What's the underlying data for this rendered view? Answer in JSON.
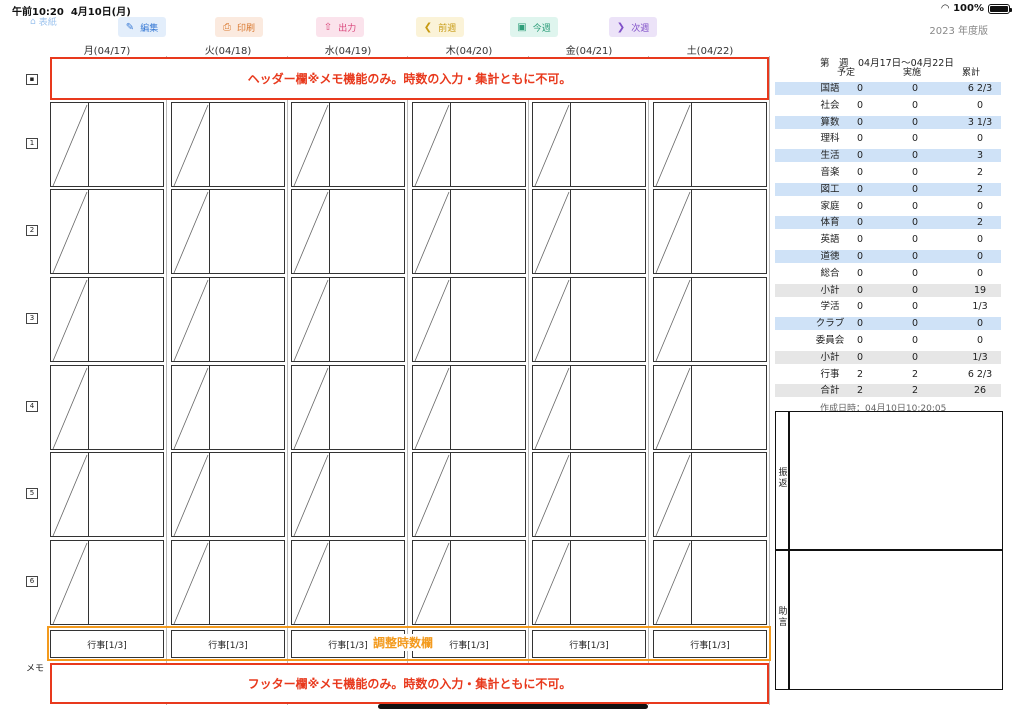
{
  "status": {
    "time": "午前10:20",
    "date": "4月10日(月)",
    "battery": "100%"
  },
  "nav": {
    "back": "表紙",
    "year": "2023 年度版"
  },
  "toolbar": [
    {
      "label": "編集",
      "icon": "edit-icon",
      "glyph": "✎",
      "bg": "#e3eefb",
      "fg": "#3a7bd5"
    },
    {
      "label": "印刷",
      "icon": "print-icon",
      "glyph": "⎙",
      "bg": "#fbeadf",
      "fg": "#d9782e"
    },
    {
      "label": "出力",
      "icon": "share-icon",
      "glyph": "⇧",
      "bg": "#fbe3ec",
      "fg": "#d9457a"
    },
    {
      "label": "前週",
      "icon": "prev-week-icon",
      "glyph": "❮",
      "bg": "#fbf3d8",
      "fg": "#c79a12"
    },
    {
      "label": "今週",
      "icon": "this-week-icon",
      "glyph": "▣",
      "bg": "#dff5ee",
      "fg": "#2e9e7a"
    },
    {
      "label": "次週",
      "icon": "next-week-icon",
      "glyph": "❯",
      "bg": "#ece3f8",
      "fg": "#8050c8"
    }
  ],
  "days": [
    "月(04/17)",
    "火(04/18)",
    "水(04/19)",
    "木(04/20)",
    "金(04/21)",
    "土(04/22)"
  ],
  "periods": [
    "1",
    "2",
    "3",
    "4",
    "5",
    "6"
  ],
  "header_note": "ヘッダー欄※メモ機能のみ。時数の入力・集計ともに不可。",
  "footer_note": "フッター欄※メモ機能のみ。時数の入力・集計ともに不可。",
  "adjust_label": "調整時数欄",
  "events": [
    "行事[1/3]",
    "行事[1/3]",
    "行事[1/3]",
    "行事[1/3]",
    "行事[1/3]",
    "行事[1/3]"
  ],
  "memo_label": "メモ",
  "summary": {
    "title": "第　週　04月17日～04月22日",
    "headers": [
      "予定",
      "実施",
      "累計"
    ],
    "rows": [
      {
        "subject": "国語",
        "planned": "0",
        "done": "0",
        "total": "6 2/3",
        "style": "hl"
      },
      {
        "subject": "社会",
        "planned": "0",
        "done": "0",
        "total": "0",
        "style": ""
      },
      {
        "subject": "算数",
        "planned": "0",
        "done": "0",
        "total": "3 1/3",
        "style": "hl"
      },
      {
        "subject": "理科",
        "planned": "0",
        "done": "0",
        "total": "0",
        "style": ""
      },
      {
        "subject": "生活",
        "planned": "0",
        "done": "0",
        "total": "3",
        "style": "hl"
      },
      {
        "subject": "音楽",
        "planned": "0",
        "done": "0",
        "total": "2",
        "style": ""
      },
      {
        "subject": "図工",
        "planned": "0",
        "done": "0",
        "total": "2",
        "style": "hl"
      },
      {
        "subject": "家庭",
        "planned": "0",
        "done": "0",
        "total": "0",
        "style": ""
      },
      {
        "subject": "体育",
        "planned": "0",
        "done": "0",
        "total": "2",
        "style": "hl"
      },
      {
        "subject": "英語",
        "planned": "0",
        "done": "0",
        "total": "0",
        "style": ""
      },
      {
        "subject": "道徳",
        "planned": "0",
        "done": "0",
        "total": "0",
        "style": "hl"
      },
      {
        "subject": "総合",
        "planned": "0",
        "done": "0",
        "total": "0",
        "style": ""
      },
      {
        "subject": "小計",
        "planned": "0",
        "done": "0",
        "total": "19",
        "style": "sub"
      },
      {
        "subject": "学活",
        "planned": "0",
        "done": "0",
        "total": "1/3",
        "style": ""
      },
      {
        "subject": "クラブ",
        "planned": "0",
        "done": "0",
        "total": "0",
        "style": "hl"
      },
      {
        "subject": "委員会",
        "planned": "0",
        "done": "0",
        "total": "0",
        "style": ""
      },
      {
        "subject": "小計",
        "planned": "0",
        "done": "0",
        "total": "1/3",
        "style": "sub"
      },
      {
        "subject": "行事",
        "planned": "2",
        "done": "2",
        "total": "6 2/3",
        "style": ""
      },
      {
        "subject": "合計",
        "planned": "2",
        "done": "2",
        "total": "26",
        "style": "sub"
      }
    ],
    "created": "作成日時：04月10日10:20:05"
  },
  "notes": {
    "top": "振返",
    "bottom": "助言"
  },
  "colors": {
    "red": "#e8391d",
    "orange": "#f39a1d",
    "highlight": "#cfe2f7"
  }
}
